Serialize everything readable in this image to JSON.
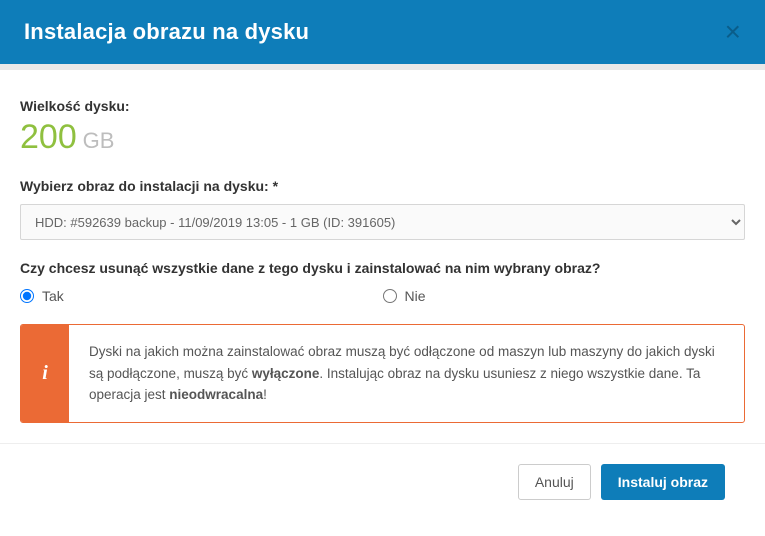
{
  "header": {
    "title": "Instalacja obrazu na dysku"
  },
  "diskSize": {
    "label": "Wielkość dysku:",
    "value": "200",
    "unit": "GB"
  },
  "imageSelect": {
    "label": "Wybierz obraz do instalacji na dysku: *",
    "selected": "HDD: #592639 backup - 11/09/2019 13:05 - 1 GB (ID: 391605)"
  },
  "eraseQuestion": {
    "label": "Czy chcesz usunąć wszystkie dane z tego dysku i zainstalować na nim wybrany obraz?",
    "yes": "Tak",
    "no": "Nie"
  },
  "alert": {
    "pre": "Dyski na jakich można zainstalować obraz muszą być odłączone od maszyn lub maszyny do jakich dyski są podłączone, muszą być ",
    "bold1": "wyłączone",
    "mid": ". Instalując obraz na dysku usuniesz z niego wszystkie dane. Ta operacja jest ",
    "bold2": "nieodwracalna",
    "post": "!"
  },
  "footer": {
    "cancel": "Anuluj",
    "install": "Instaluj obraz"
  }
}
